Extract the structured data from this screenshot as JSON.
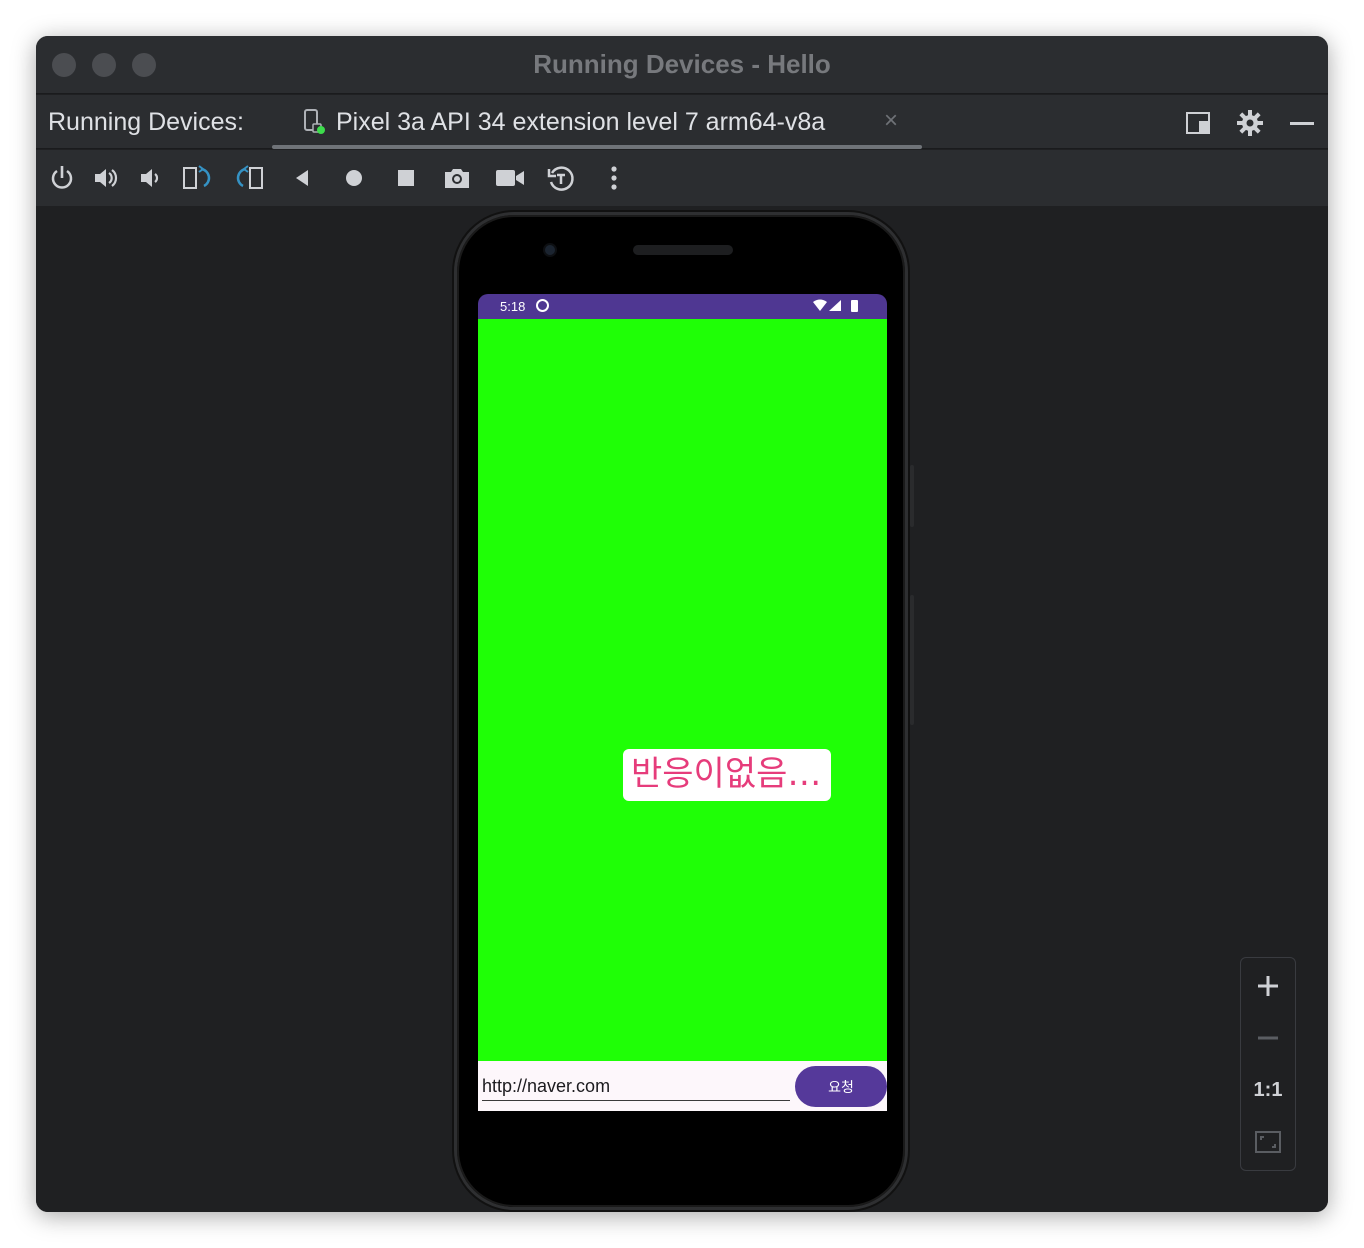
{
  "window": {
    "title": "Running Devices - Hello"
  },
  "tabbar": {
    "label": "Running Devices:",
    "device_tab": {
      "icon": "phone-device-icon",
      "label": "Pixel 3a API 34 extension level 7 arm64-v8a",
      "close": "×"
    },
    "actions": [
      "layout-icon",
      "gear-icon",
      "minimize-icon"
    ]
  },
  "toolbar": {
    "tools": [
      "power-icon",
      "volume-up-icon",
      "volume-down-icon",
      "rotate-left-icon",
      "rotate-right-icon",
      "back-icon",
      "home-icon",
      "overview-icon",
      "screenshot-icon",
      "screen-record-icon",
      "snapshot-restore-icon",
      "more-options-icon"
    ]
  },
  "phone": {
    "status": {
      "time": "5:18",
      "icons": [
        "wifi-icon",
        "signal-icon",
        "battery-icon"
      ]
    },
    "colors": {
      "status_bar": "#4f3792",
      "content_bg": "#1fff06",
      "toast_text": "#e63c7b",
      "button_bg": "#55399a"
    },
    "toast_text": "반응이없음…",
    "url_input": {
      "value": "http://naver.com"
    },
    "request_button": "요청"
  },
  "zoom": {
    "zoom_in": "+",
    "zoom_out": "−",
    "actual_size": "1:1",
    "fit_icon": "fit-screen-icon"
  }
}
